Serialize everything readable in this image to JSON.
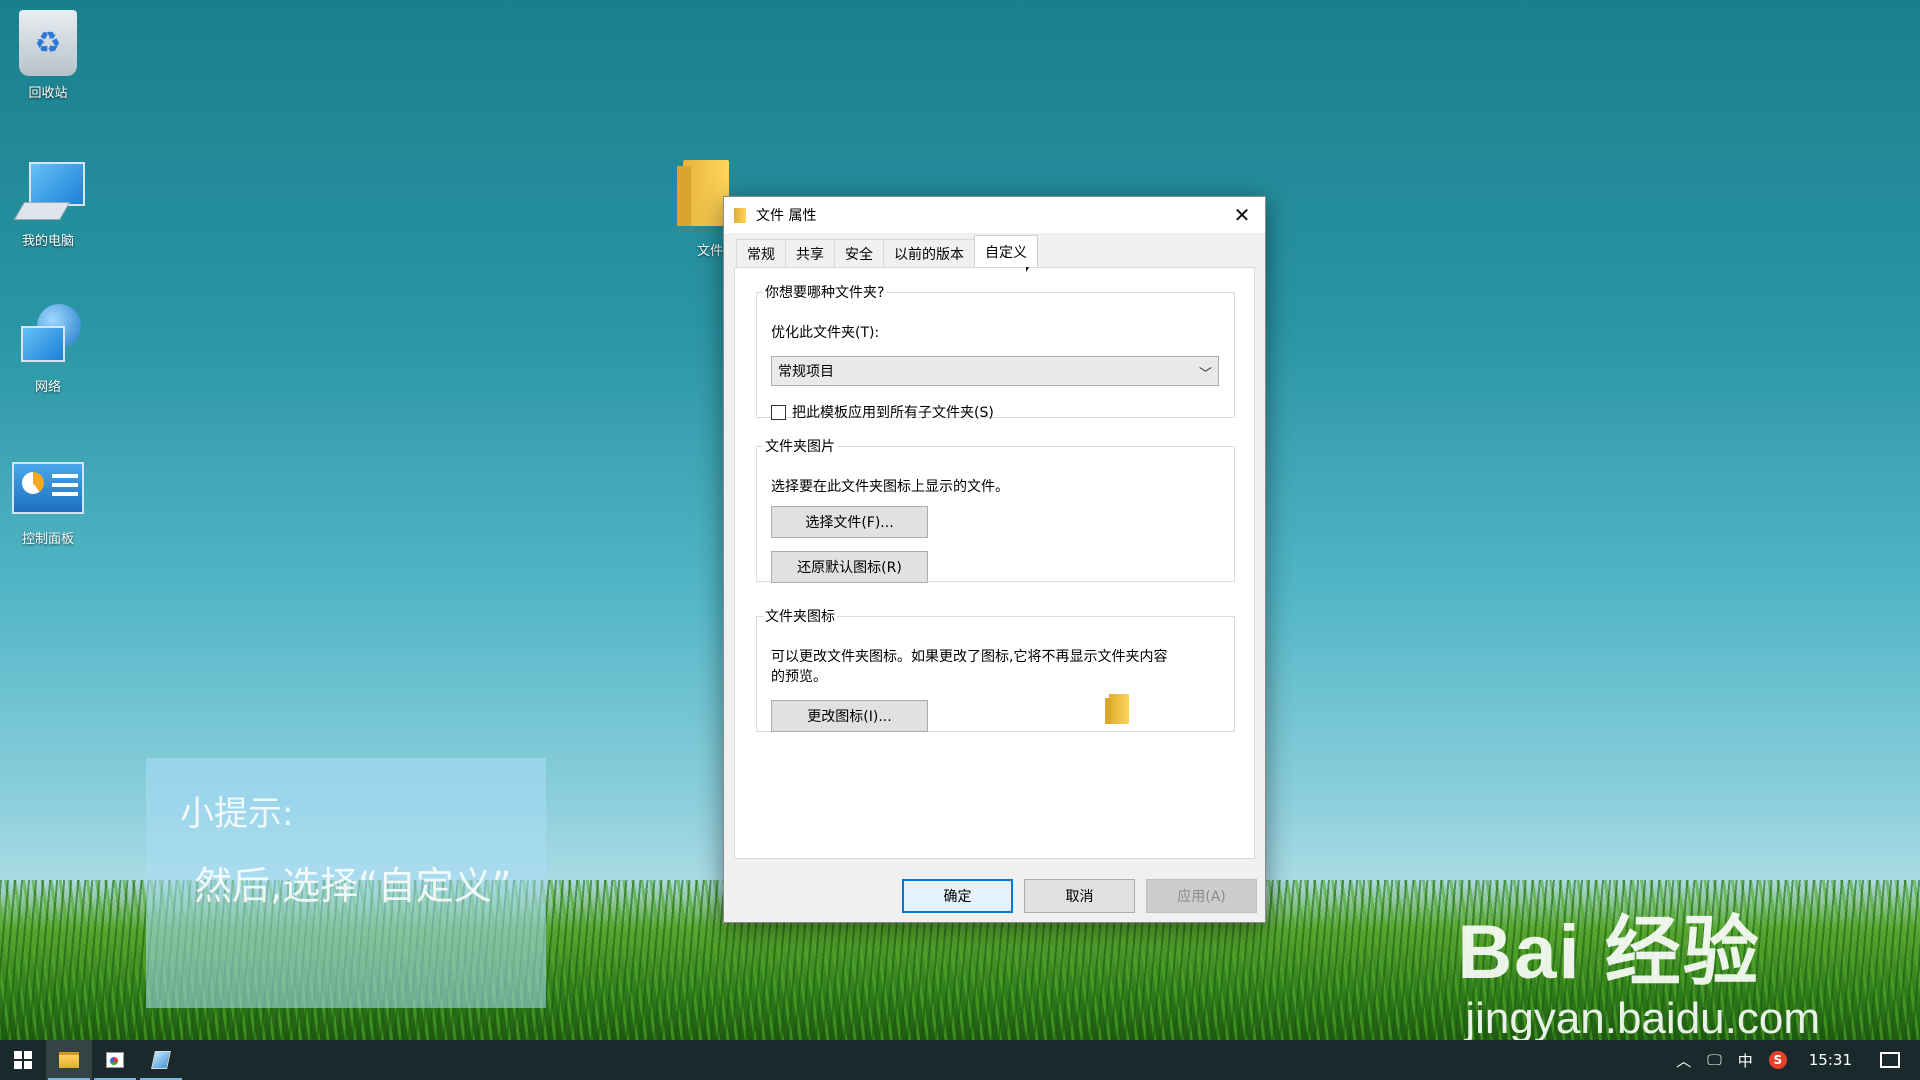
{
  "desktop": {
    "icons": [
      {
        "label": "回收站"
      },
      {
        "label": "我的电脑"
      },
      {
        "label": "网络"
      },
      {
        "label": "控制面板"
      }
    ],
    "folder_label": "文件"
  },
  "tip": {
    "title": "小提示:",
    "body": "然后,选择“自定义”"
  },
  "watermark": {
    "brand": "Bai 经验",
    "url": "jingyan.baidu.com"
  },
  "dialog": {
    "title": "文件 属性",
    "tabs": [
      {
        "label": "常规"
      },
      {
        "label": "共享"
      },
      {
        "label": "安全"
      },
      {
        "label": "以前的版本"
      },
      {
        "label": "自定义",
        "active": true
      }
    ],
    "group_type": {
      "legend": "你想要哪种文件夹?",
      "optimize_label": "优化此文件夹(T):",
      "optimize_value": "常规项目",
      "apply_subfolders_label": "把此模板应用到所有子文件夹(S)",
      "apply_subfolders_checked": false
    },
    "group_picture": {
      "legend": "文件夹图片",
      "description": "选择要在此文件夹图标上显示的文件。",
      "choose_file_button": "选择文件(F)...",
      "restore_default_button": "还原默认图标(R)"
    },
    "group_icon": {
      "legend": "文件夹图标",
      "description_line1": "可以更改文件夹图标。如果更改了图标,它将不再显示文件夹内容",
      "description_line2": "的预览。",
      "change_icon_button": "更改图标(I)..."
    },
    "footer": {
      "ok": "确定",
      "cancel": "取消",
      "apply": "应用(A)"
    }
  },
  "taskbar": {
    "tray": {
      "ime": "中",
      "sogou": "S",
      "clock": "15:31"
    }
  }
}
